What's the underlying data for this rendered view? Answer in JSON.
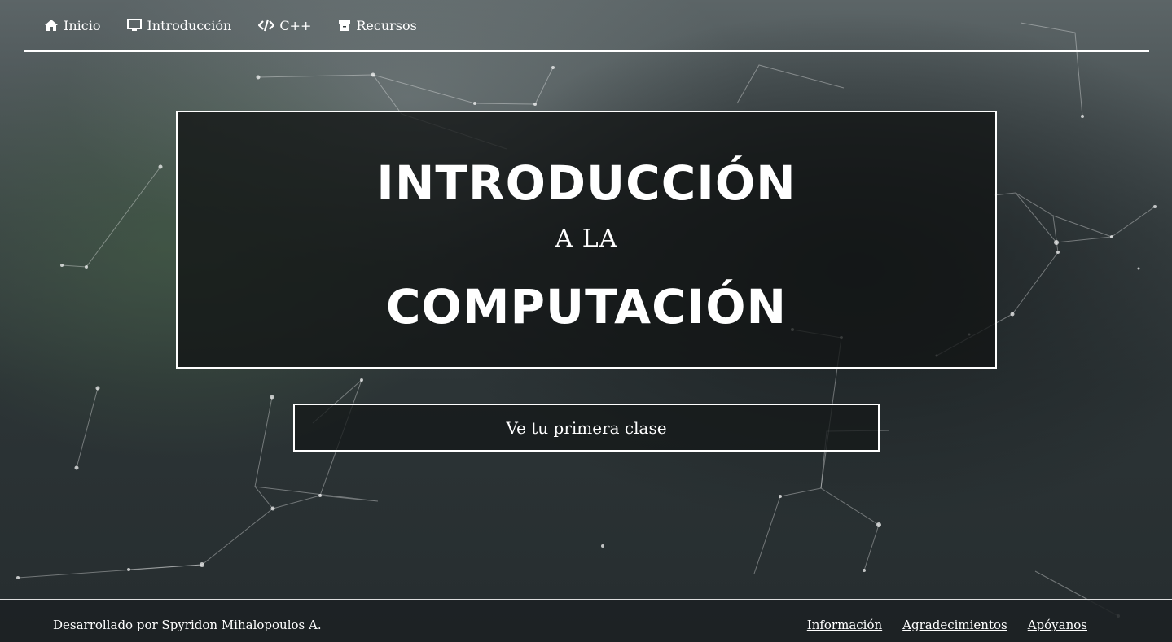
{
  "nav": {
    "items": [
      {
        "icon": "home-icon",
        "label": "Inicio"
      },
      {
        "icon": "monitor-icon",
        "label": "Introducción"
      },
      {
        "icon": "code-icon",
        "label": "C++"
      },
      {
        "icon": "archive-icon",
        "label": "Recursos"
      }
    ]
  },
  "hero": {
    "title_line_1": "INTRODUCCIÓN",
    "subtitle": "A LA",
    "title_line_2": "COMPUTACIÓN",
    "cta_label": "Ve tu primera clase"
  },
  "footer": {
    "credit": "Desarrollado por Spyridon Mihalopoulos A.",
    "links": [
      "Información",
      "Agradecimientos",
      "Apóyanos"
    ]
  },
  "colors": {
    "text": "#ffffff",
    "overlay": "#141818"
  }
}
